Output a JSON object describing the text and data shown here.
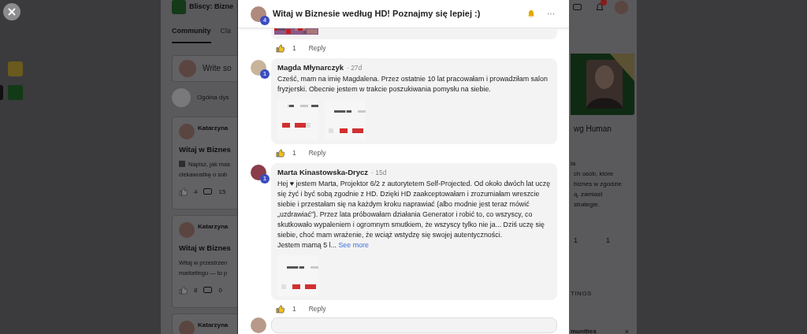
{
  "community": {
    "name": "Bliscy: Bizne",
    "tabs": [
      {
        "label": "Community",
        "selected": true
      },
      {
        "label": "Cla",
        "selected": false
      }
    ],
    "composer": {
      "placeholder": "Write so"
    },
    "channel_hint": "Ogólna dys",
    "posts": [
      {
        "kind": "emoji_text",
        "author": "Katarzyna",
        "title": "Witaj w Biznes",
        "text_lines": [
          "Napisz, jak mas",
          "ciekawostkę o sob"
        ],
        "likes": "4",
        "comments": "15"
      },
      {
        "kind": "text",
        "author": "Katarzyna",
        "title": "Witaj w Biznes",
        "text_lines": [
          "Witaj w przestrzen",
          "marketingu — to p"
        ],
        "likes": "8",
        "comments": "0"
      },
      {
        "kind": "cut",
        "author": "Katarzyna"
      }
    ]
  },
  "modal": {
    "title": "Witaj w Biznesie według HD! Poznajmy się lepiej :)",
    "author_badge": "4",
    "more": "···",
    "comments": [
      {
        "kind": "cut",
        "likes": "1",
        "reply": "Reply"
      },
      {
        "kind": "full",
        "author": "Magda Młynarczyk",
        "badge": "1",
        "time": "· 27d",
        "text": "Cześć, mam na imię Magdalena. Przez ostatnie 10 lat pracowałam i prowadziłam salon fryzjerski. Obecnie jestem w trakcie poszukiwania pomysłu na siebie.",
        "likes": "1",
        "reply": "Reply"
      },
      {
        "kind": "full",
        "author": "Marta Kinastowska-Drycz",
        "badge": "1",
        "time": "· 15d",
        "text": "Hej ♥ jestem Marta, Projektor 6/2 z autorytetem Self-Projected. Od około dwóch lat uczę się żyć i być sobą zgodnie z HD. Dzięki HD zaakceptowałam i zrozumiałam wreszcie siebie i przestałam się na każdym kroku naprawiać (albo modnie jest teraz mówić „uzdrawiać”). Przez lata próbowałam działania Generator i robić to, co wszyscy, co skutkowało wypaleniem i ogromnym smutkiem, że wszyscy tylko nie ja... Dziś uczę się siebie, choć mam wrażenie, że wciąż wstydzę się swojej autentyczności.\nJestem mamą 5 l...",
        "see_more": "See more",
        "likes": "1",
        "reply": "Reply"
      }
    ]
  },
  "about": {
    "name": "wg Human",
    "description_lines": [
      "la",
      "ch osób, które",
      "biznes w zgodzie",
      "ą, zamiast",
      "strategie."
    ],
    "stats": [
      {
        "value": "1"
      },
      {
        "value": "1"
      }
    ],
    "section": "TINGS",
    "communities": {
      "title": "munities",
      "close": "×"
    }
  }
}
